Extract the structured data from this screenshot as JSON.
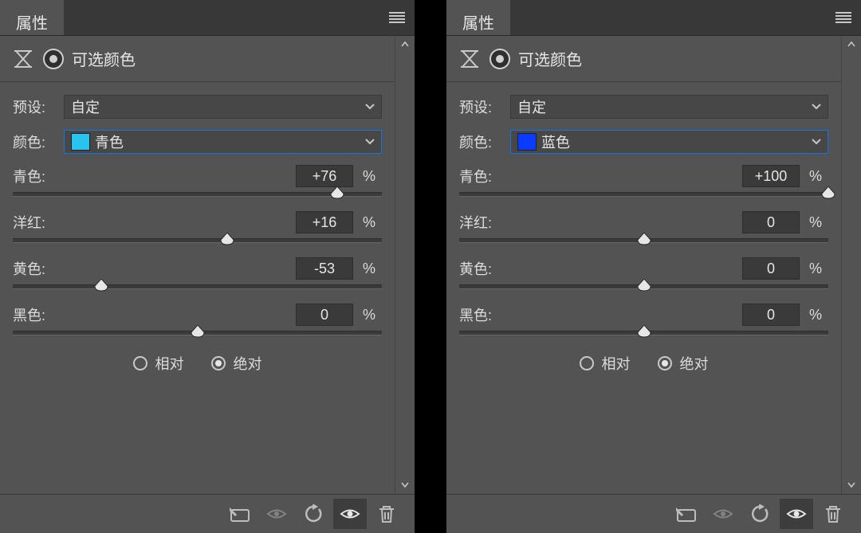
{
  "panels": [
    {
      "tab_title": "属性",
      "adjustment_title": "可选颜色",
      "preset_label": "预设:",
      "preset_value": "自定",
      "color_label": "颜色:",
      "color_value": "青色",
      "swatch_hex": "#29c3ef",
      "sliders": [
        {
          "label": "青色:",
          "value": "+76",
          "unit": "%",
          "pos_pct": 88
        },
        {
          "label": "洋红:",
          "value": "+16",
          "unit": "%",
          "pos_pct": 58
        },
        {
          "label": "黄色:",
          "value": "-53",
          "unit": "%",
          "pos_pct": 24
        },
        {
          "label": "黑色:",
          "value": "0",
          "unit": "%",
          "pos_pct": 50
        }
      ],
      "method": {
        "relative_label": "相对",
        "absolute_label": "绝对",
        "selected": "absolute"
      }
    },
    {
      "tab_title": "属性",
      "adjustment_title": "可选颜色",
      "preset_label": "预设:",
      "preset_value": "自定",
      "color_label": "颜色:",
      "color_value": "蓝色",
      "swatch_hex": "#0a3cff",
      "sliders": [
        {
          "label": "青色:",
          "value": "+100",
          "unit": "%",
          "pos_pct": 100
        },
        {
          "label": "洋红:",
          "value": "0",
          "unit": "%",
          "pos_pct": 50
        },
        {
          "label": "黄色:",
          "value": "0",
          "unit": "%",
          "pos_pct": 50
        },
        {
          "label": "黑色:",
          "value": "0",
          "unit": "%",
          "pos_pct": 50
        }
      ],
      "method": {
        "relative_label": "相对",
        "absolute_label": "绝对",
        "selected": "absolute"
      }
    }
  ]
}
